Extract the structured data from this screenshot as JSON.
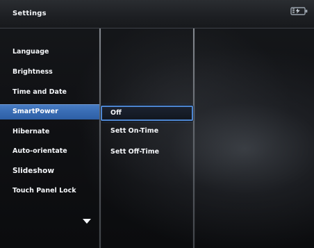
{
  "header": {
    "title": "Settings",
    "battery_icon": "battery-icon"
  },
  "menu": {
    "items": [
      {
        "label": "Language"
      },
      {
        "label": "Brightness"
      },
      {
        "label": "Time and Date"
      },
      {
        "label": "SmartPower",
        "selected": true
      },
      {
        "label": "Hibernate"
      },
      {
        "label": "Auto-orientate"
      },
      {
        "label": "Slideshow"
      },
      {
        "label": "Touch Panel Lock"
      }
    ],
    "more_indicator": "chevron-down-icon"
  },
  "submenu": {
    "items": [
      {
        "label": "Off",
        "focused": true
      },
      {
        "label": "Sett On-Time"
      },
      {
        "label": "Sett Off-Time"
      }
    ]
  },
  "colors": {
    "selection_blue": "#3b6fb7",
    "focus_outline": "#4e87d3",
    "header_bg": "#1e2024"
  }
}
